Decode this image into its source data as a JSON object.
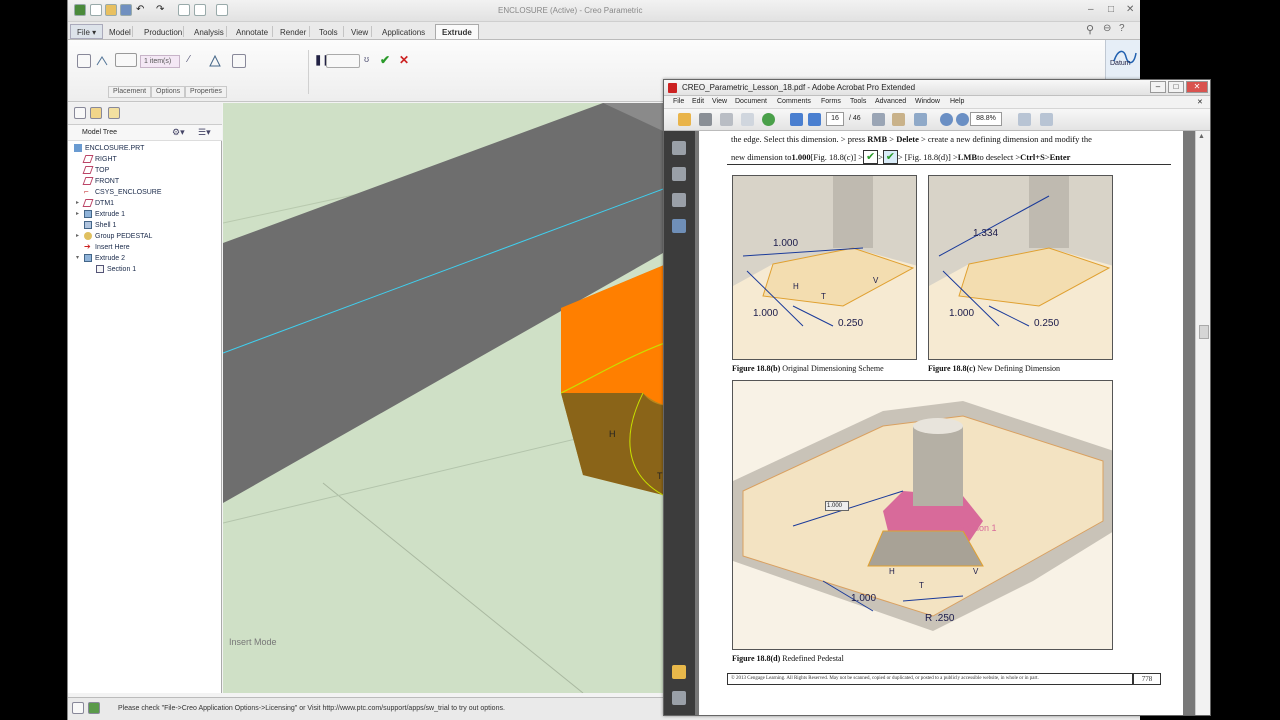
{
  "creo": {
    "window_title": "ENCLOSURE (Active) - Creo Parametric",
    "tabs": [
      "File",
      "Model",
      "Production",
      "Analysis",
      "Annotate",
      "Render",
      "Tools",
      "View",
      "Applications",
      "Extrude"
    ],
    "active_tab": "Extrude",
    "ribbon": {
      "depth_value": "1 item(s)",
      "subtabs": [
        "Placement",
        "Options",
        "Properties"
      ],
      "datum_label": "Datum"
    },
    "model_tree": {
      "title": "Model Tree",
      "items": [
        "ENCLOSURE.PRT",
        "RIGHT",
        "TOP",
        "FRONT",
        "CSYS_ENCLOSURE",
        "DTM1",
        "Extrude 1",
        "Shell 1",
        "Group PEDESTAL",
        "Insert Here",
        "Extrude 2",
        "Section 1"
      ]
    },
    "viewport": {
      "mode_label": "Insert Mode",
      "labels": [
        "H",
        "T",
        "T"
      ]
    },
    "status_message": "Please check \"File->Creo Application Options->Licensing\" or Visit http://www.ptc.com/support/apps/sw_trial to try out options."
  },
  "acrobat": {
    "title": "CREO_Parametric_Lesson_18.pdf - Adobe Acrobat Pro Extended",
    "menu": [
      "File",
      "Edit",
      "View",
      "Document",
      "Comments",
      "Forms",
      "Tools",
      "Advanced",
      "Window",
      "Help"
    ],
    "page_number": "16",
    "page_total": "/ 46",
    "zoom": "88.8%",
    "doc": {
      "line1_pre": "the edge. Select this dimension. > press ",
      "line1_rmb": "RMB",
      "line1_gt": " > ",
      "line1_delete": "Delete",
      "line1_post": " > create a new defining dimension and modify the",
      "line2_pre": "new dimension to ",
      "line2_value": "1.000",
      "line2_ref1": " [Fig. 18.8(c)] > ",
      "line2_ref2": " > [Fig. 18.8(d)] > ",
      "line2_lmb": "LMB",
      "line2_mid": " to deselect > ",
      "line2_ctrl": "Ctrl+S",
      "line2_gt": " > ",
      "line2_enter": "Enter",
      "fig_b_bold": "Figure 18.8(b)",
      "fig_b_rest": " Original Dimensioning Scheme",
      "fig_c_bold": "Figure 18.8(c)",
      "fig_c_rest": " New Defining Dimension",
      "fig_d_bold": "Figure 18.8(d)",
      "fig_d_rest": " Redefined Pedestal",
      "fig_b_dims": [
        "1.000",
        "1.000",
        "0.250"
      ],
      "fig_c_dims": [
        "1.334",
        "1.000",
        "0.250"
      ],
      "fig_d_dims": [
        "1.000",
        "1.000",
        "R .250"
      ],
      "fig_d_section_label": "Section 1",
      "fig_letters": [
        "H",
        "T",
        "T",
        "V"
      ],
      "footer_text": "© 2013 Cengage Learning. All Rights Reserved. May not be scanned, copied or duplicated, or posted to a publicly accessible website, in whole or in part.",
      "footer_page": "778"
    }
  },
  "colors": {
    "orange_face": "#ff7f00",
    "wall_gray": "#6e6e6e",
    "viewport_bg": "#cfe0c6",
    "sketch_yellow": "#c8e000",
    "cyan_line": "#3fd0f0",
    "fig_fill": "#f3ddb0"
  }
}
